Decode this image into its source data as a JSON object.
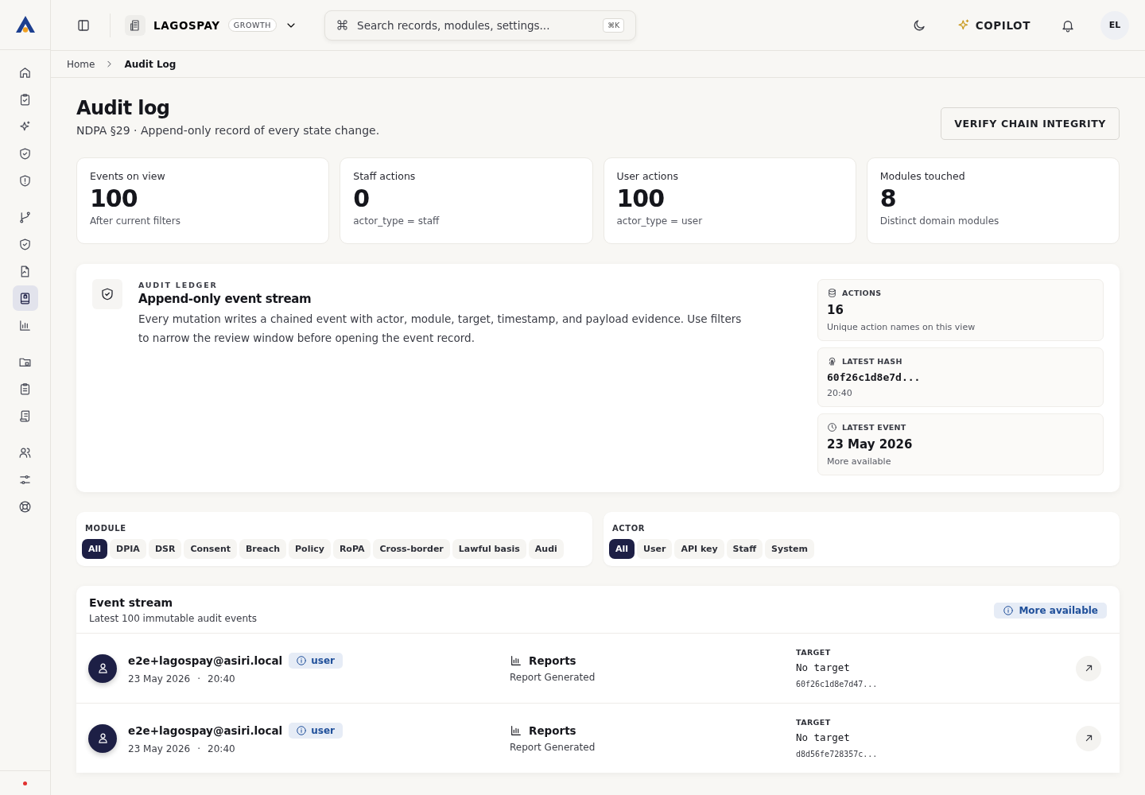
{
  "sidebar": {
    "groups": [
      {
        "items": [
          {
            "selected": false
          },
          {
            "selected": false
          },
          {
            "selected": false
          },
          {
            "selected": false
          },
          {
            "selected": false
          }
        ]
      },
      {
        "items": [
          {
            "selected": false
          },
          {
            "selected": false
          },
          {
            "selected": false
          },
          {
            "selected": true
          },
          {
            "selected": false
          }
        ]
      },
      {
        "items": [
          {
            "selected": false
          },
          {
            "selected": false
          },
          {
            "selected": false
          }
        ]
      },
      {
        "items": [
          {
            "selected": false
          },
          {
            "selected": false
          },
          {
            "selected": false
          }
        ]
      }
    ]
  },
  "topbar": {
    "org": "LAGOSPAY",
    "plan": "GROWTH",
    "search_placeholder": "Search records, modules, settings...",
    "shortcut": "⌘K",
    "copilot": "COPILOT",
    "avatar": "EL"
  },
  "breadcrumb": [
    {
      "label": "Home",
      "current": false
    },
    {
      "label": "Audit Log",
      "current": true
    }
  ],
  "page": {
    "title": "Audit log",
    "subtitle": "NDPA §29 · Append-only record of every state change.",
    "action": "VERIFY CHAIN INTEGRITY"
  },
  "stats": [
    {
      "label": "Events on view",
      "value": "100",
      "note": "After current filters"
    },
    {
      "label": "Staff actions",
      "value": "0",
      "note": "actor_type = staff"
    },
    {
      "label": "User actions",
      "value": "100",
      "note": "actor_type = user"
    },
    {
      "label": "Modules touched",
      "value": "8",
      "note": "Distinct domain modules"
    }
  ],
  "ledger": {
    "eyebrow": "AUDIT LEDGER",
    "title": "Append-only event stream",
    "body": "Every mutation writes a chained event with actor, module, target, timestamp, and payload evidence. Use filters to narrow the review window before opening the event record.",
    "facts": [
      {
        "kind": "count",
        "label": "ACTIONS",
        "value": "16",
        "note": "Unique action names on this view"
      },
      {
        "kind": "hash",
        "label": "LATEST HASH",
        "value": "60f26c1d8e7d...",
        "note": "20:40"
      },
      {
        "kind": "date",
        "label": "LATEST EVENT",
        "value": "23 May 2026",
        "note": "More available"
      }
    ]
  },
  "filters": [
    {
      "label": "MODULE",
      "options": [
        {
          "label": "All",
          "selected": true
        },
        {
          "label": "DPIA",
          "selected": false
        },
        {
          "label": "DSR",
          "selected": false
        },
        {
          "label": "Consent",
          "selected": false
        },
        {
          "label": "Breach",
          "selected": false
        },
        {
          "label": "Policy",
          "selected": false
        },
        {
          "label": "RoPA",
          "selected": false
        },
        {
          "label": "Cross-border",
          "selected": false
        },
        {
          "label": "Lawful basis",
          "selected": false
        },
        {
          "label": "Audi",
          "selected": false
        }
      ]
    },
    {
      "label": "ACTOR",
      "options": [
        {
          "label": "All",
          "selected": true
        },
        {
          "label": "User",
          "selected": false
        },
        {
          "label": "API key",
          "selected": false
        },
        {
          "label": "Staff",
          "selected": false
        },
        {
          "label": "System",
          "selected": false
        }
      ]
    }
  ],
  "stream": {
    "title": "Event stream",
    "subtitle": "Latest 100 immutable audit events",
    "badge": "More available",
    "events": [
      {
        "actor": "e2e+lagospay@asiri.local",
        "role": "user",
        "date": "23 May 2026",
        "sep": "·",
        "time": "20:40",
        "module": "Reports",
        "action": "Report Generated",
        "target_label": "TARGET",
        "target": "No target",
        "hash": "60f26c1d8e7d47..."
      },
      {
        "actor": "e2e+lagospay@asiri.local",
        "role": "user",
        "date": "23 May 2026",
        "sep": "·",
        "time": "20:40",
        "module": "Reports",
        "action": "Report Generated",
        "target_label": "TARGET",
        "target": "No target",
        "hash": "d8d56fe728357c..."
      }
    ]
  }
}
